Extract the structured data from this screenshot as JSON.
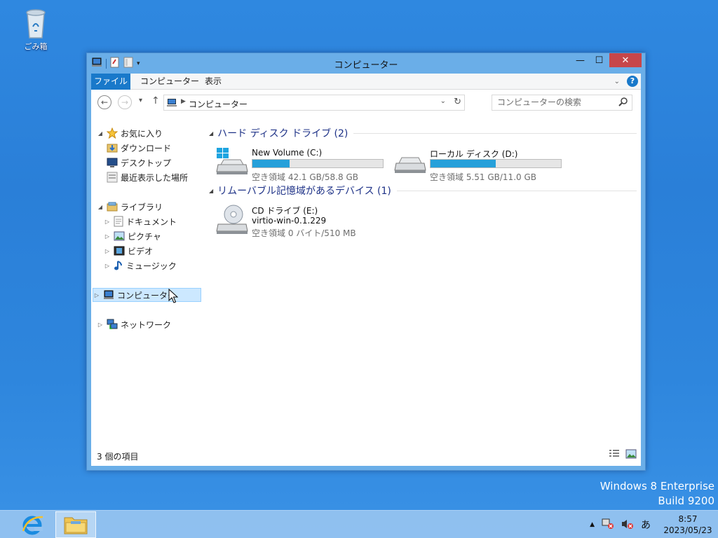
{
  "desktop": {
    "recycle_bin_label": "ごみ箱",
    "watermark_line1": "Windows 8 Enterprise",
    "watermark_line2": "Build 9200"
  },
  "window": {
    "title": "コンピューター",
    "controls": {
      "minimize": "—",
      "maximize": "☐",
      "close": "✕"
    },
    "ribbon_tabs": [
      "ファイル",
      "コンピューター",
      "表示"
    ],
    "address": "コンピューター",
    "search_placeholder": "コンピューターの検索",
    "nav": {
      "favorites": "お気に入り",
      "downloads": "ダウンロード",
      "desktop": "デスクトップ",
      "recent": "最近表示した場所",
      "libraries": "ライブラリ",
      "documents": "ドキュメント",
      "pictures": "ピクチャ",
      "videos": "ビデオ",
      "music": "ミュージック",
      "computer": "コンピューター",
      "network": "ネットワーク"
    },
    "groups": {
      "hard_disks": "ハード ディスク ドライブ (2)",
      "removable": "リムーバブル記憶域があるデバイス (1)"
    },
    "drives": [
      {
        "name": "New Volume (C:)",
        "free_text": "空き領域 42.1 GB/58.8 GB",
        "used_fraction": 0.284
      },
      {
        "name": "ローカル ディスク (D:)",
        "free_text": "空き領域 5.51 GB/11.0 GB",
        "used_fraction": 0.5
      }
    ],
    "cd": {
      "name": "CD ドライブ (E:)",
      "label": "virtio-win-0.1.229",
      "free_text": "空き領域 0 バイト/510 MB"
    },
    "status_count": "3 個の項目"
  },
  "taskbar": {
    "ime": "あ",
    "time": "8:57",
    "date": "2023/05/23"
  },
  "colors": {
    "accent": "#1979ca",
    "bar_fill": "#26a0da",
    "close": "#c7464a"
  }
}
